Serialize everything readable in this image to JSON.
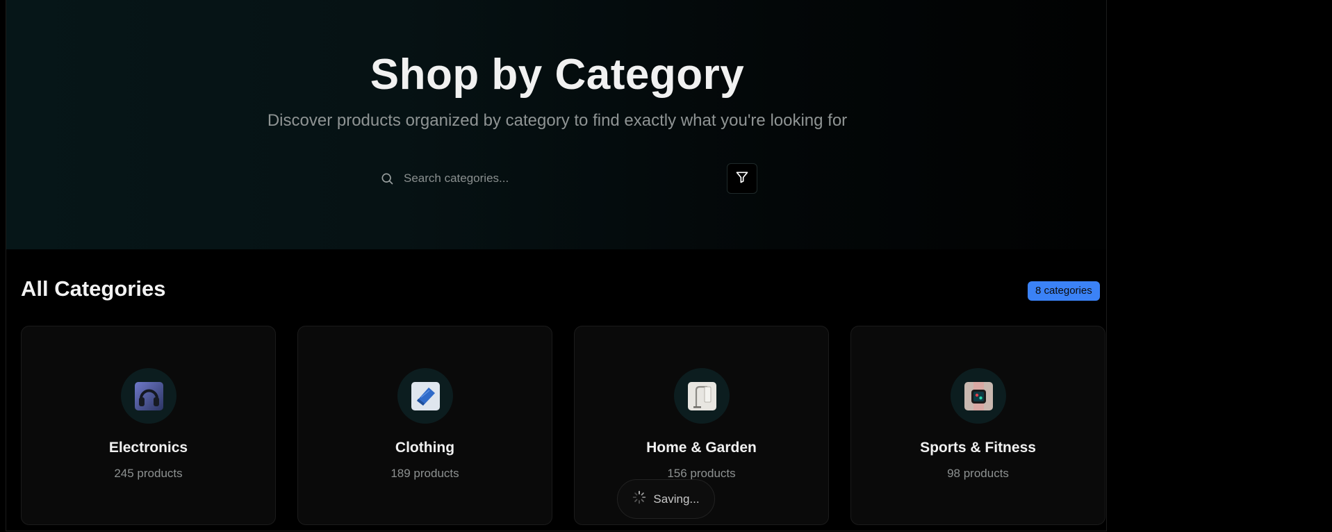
{
  "hero": {
    "title": "Shop by Category",
    "subtitle": "Discover products organized by category to find exactly what you're looking for",
    "search_placeholder": "Search categories...",
    "search_icon": "search-icon",
    "filter_icon": "filter-icon"
  },
  "section": {
    "title": "All Categories",
    "count_badge": "8 categories"
  },
  "categories": [
    {
      "name": "Electronics",
      "count": "245 products",
      "icon": "headphones-image"
    },
    {
      "name": "Clothing",
      "count": "189 products",
      "icon": "folded-shirt-image"
    },
    {
      "name": "Home & Garden",
      "count": "156 products",
      "icon": "lamp-image"
    },
    {
      "name": "Sports & Fitness",
      "count": "98 products",
      "icon": "smartwatch-image"
    }
  ],
  "toast": {
    "label": "Saving...",
    "icon": "spinner-icon"
  },
  "colors": {
    "accent": "#3b82f6",
    "background": "#000000",
    "card": "#0a0a0a",
    "icon_circle": "#0c1d1f"
  }
}
